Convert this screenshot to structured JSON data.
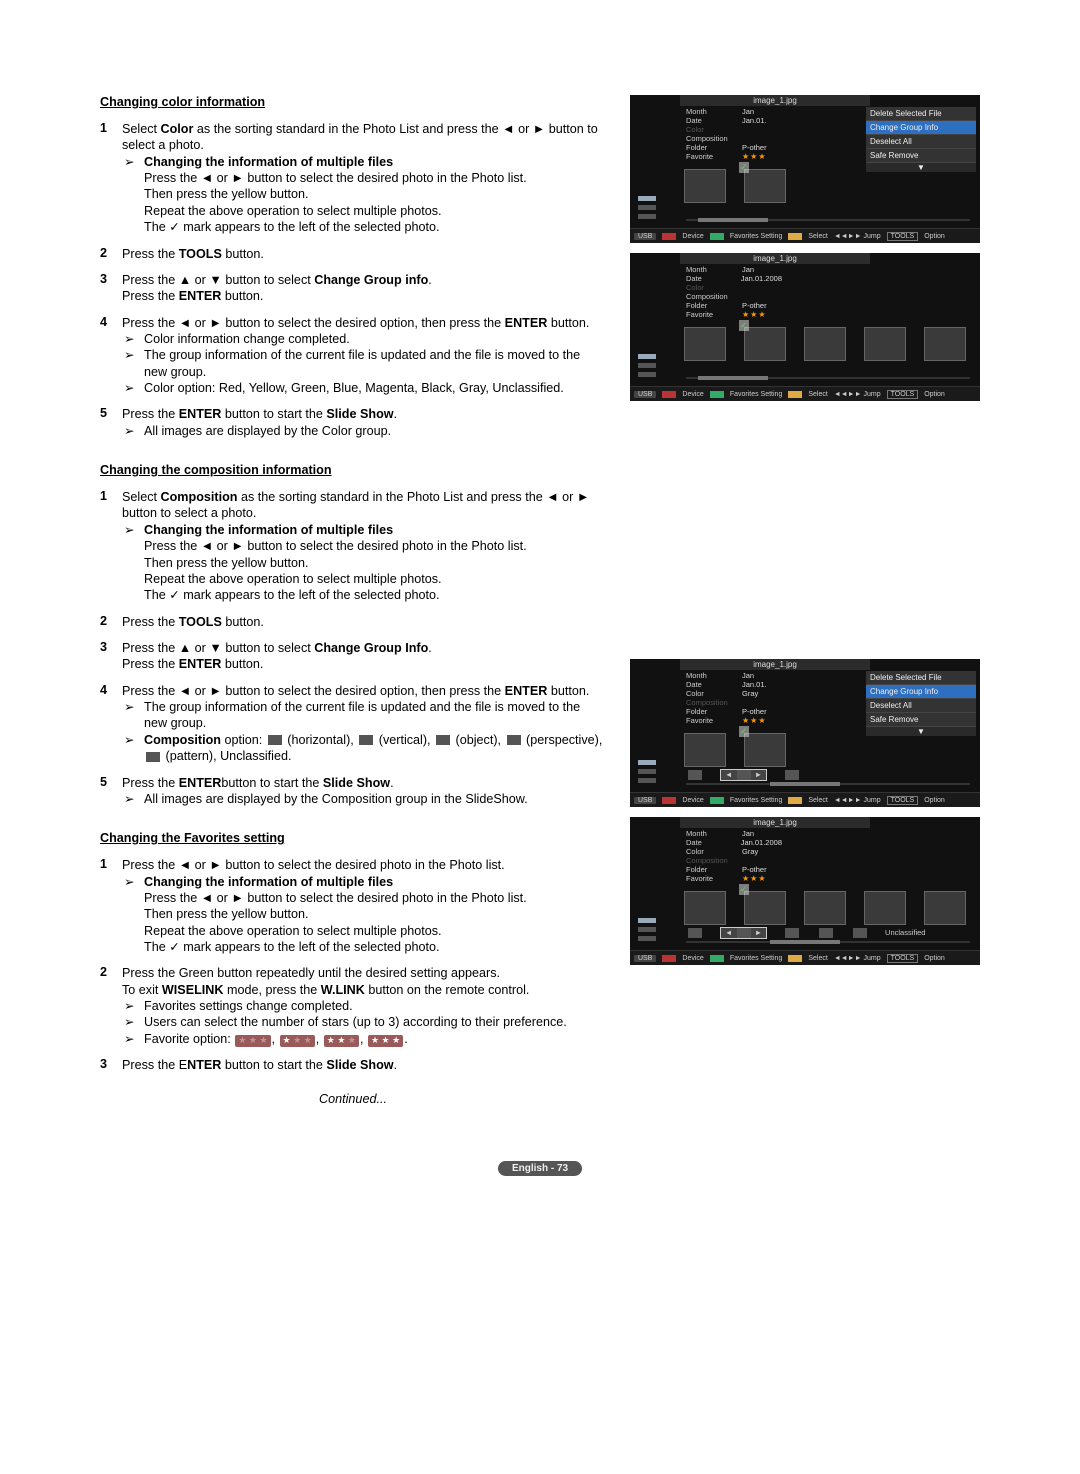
{
  "sections": {
    "color": {
      "title": "Changing color information",
      "steps": [
        {
          "num": "1",
          "text_a": "Select ",
          "bold_a": "Color",
          "text_b": " as the sorting standard in the Photo List and press the ◄ or ► button to select a photo.",
          "sub_title": "Changing the information of multiple files",
          "sub_lines": [
            "Press the ◄ or ► button to select the desired photo in the Photo list.",
            "Then press the yellow button.",
            "Repeat the above operation to select multiple photos.",
            "The ✓ mark appears to the left of the selected photo."
          ]
        },
        {
          "num": "2",
          "text_a": "Press the ",
          "bold_a": "TOOLS",
          "text_b": " button."
        },
        {
          "num": "3",
          "line1_a": "Press the ▲ or ▼ button to select ",
          "line1_bold": "Change Group info",
          "line1_b": ".",
          "line2_a": "Press the ",
          "line2_bold": "ENTER",
          "line2_b": " button."
        },
        {
          "num": "4",
          "line1_a": "Press the ◄ or ► button to select the desired option, then press the ",
          "line1_bold": "ENTER",
          "line1_b": " button.",
          "arrows": [
            "Color information change completed.",
            "The group information of the current file is updated and the file is moved to the new group.",
            "Color option: Red, Yellow, Green, Blue, Magenta, Black, Gray, Unclassified."
          ]
        },
        {
          "num": "5",
          "line1_a": "Press the ",
          "line1_bold": "ENTER",
          "line1_b": " button to start the ",
          "line1_bold2": "Slide Show",
          "line1_c": ".",
          "arrows": [
            "All images are displayed by the Color group."
          ]
        }
      ]
    },
    "composition": {
      "title": "Changing the composition information",
      "steps": [
        {
          "num": "1",
          "text_a": "Select ",
          "bold_a": "Composition",
          "text_b": " as the sorting standard in the Photo List and press the ◄ or ► button to select a photo.",
          "sub_title": "Changing the information of multiple files",
          "sub_lines": [
            "Press the ◄ or ► button to select the desired photo in the Photo list.",
            "Then press the yellow button.",
            "Repeat the above operation to select multiple photos.",
            "The ✓ mark appears to the left of the selected photo."
          ]
        },
        {
          "num": "2",
          "text_a": "Press the ",
          "bold_a": "TOOLS",
          "text_b": " button."
        },
        {
          "num": "3",
          "line1_a": "Press the ▲ or ▼ button to select ",
          "line1_bold": "Change Group Info",
          "line1_b": ".",
          "line2_a": "Press the ",
          "line2_bold": "ENTER",
          "line2_b": " button."
        },
        {
          "num": "4",
          "line1_a": "Press the ◄ or ► button to select the desired option, then press the ",
          "line1_bold": "ENTER",
          "line1_b": " button.",
          "arrows_lead": "The group information of the current file is updated and the file is moved to the new group.",
          "comp_label": "Composition",
          "comp_tail": " option:      (horizontal),      (vertical),      (object),      (perspective),      (pattern), Unclassified."
        },
        {
          "num": "5",
          "line1_a": "Press the ",
          "line1_bold": "ENTER",
          "line1_b": "button to start the ",
          "line1_bold2": "Slide Show",
          "line1_c": ".",
          "arrows": [
            "All images are displayed by the Composition group in the SlideShow."
          ]
        }
      ]
    },
    "favorites": {
      "title": "Changing the Favorites setting",
      "steps": [
        {
          "num": "1",
          "text_a": "Press the ◄ or ► button to select the desired photo in the Photo list.",
          "sub_title": "Changing the information of multiple files",
          "sub_lines": [
            "Press the ◄ or ► button to select the desired photo in the Photo list.",
            "Then press the yellow button.",
            "Repeat the above operation to select multiple photos.",
            "The ✓ mark appears to the left of the selected photo."
          ]
        },
        {
          "num": "2",
          "line1": "Press the Green button repeatedly until the desired setting appears.",
          "line2_a": "To exit ",
          "line2_bold": "WISELINK",
          "line2_b": " mode, press the ",
          "line2_bold2": "W.LINK",
          "line2_c": " button on the remote control.",
          "arrows": [
            "Favorites settings change completed.",
            "Users can select the number of stars (up to 3) according to their preference."
          ],
          "fav_label": "Favorite option: "
        },
        {
          "num": "3",
          "line1_a": "Press the E",
          "line1_bold": "NTER",
          "line1_b": " button to start the ",
          "line1_bold2": "Slide Show",
          "line1_c": "."
        }
      ]
    }
  },
  "continued": "Continued...",
  "page_label": "English - 73",
  "shot": {
    "title1": "image_1.jpg",
    "info_labels": {
      "month": "Month",
      "date": "Date",
      "color": "Color",
      "composition": "Composition",
      "folder": "Folder",
      "favorite": "Favorite"
    },
    "info_values": {
      "month": "Jan",
      "date1": "Jan.01.",
      "date2": "Jan.01.2008",
      "color": "Gray",
      "pother": "P-other"
    },
    "menu": {
      "delete": "Delete Selected File",
      "change": "Change Group Info",
      "deselect": "Deselect All",
      "safe": "Safe Remove",
      "down": "▼"
    },
    "footer": {
      "usb": "USB",
      "device": "Device",
      "fav": "Favorites Setting",
      "select": "Select",
      "jump": "◄◄►► Jump",
      "tools": "TOOLS",
      "option": "Option"
    },
    "comp_options": [
      "Unclassified"
    ]
  }
}
